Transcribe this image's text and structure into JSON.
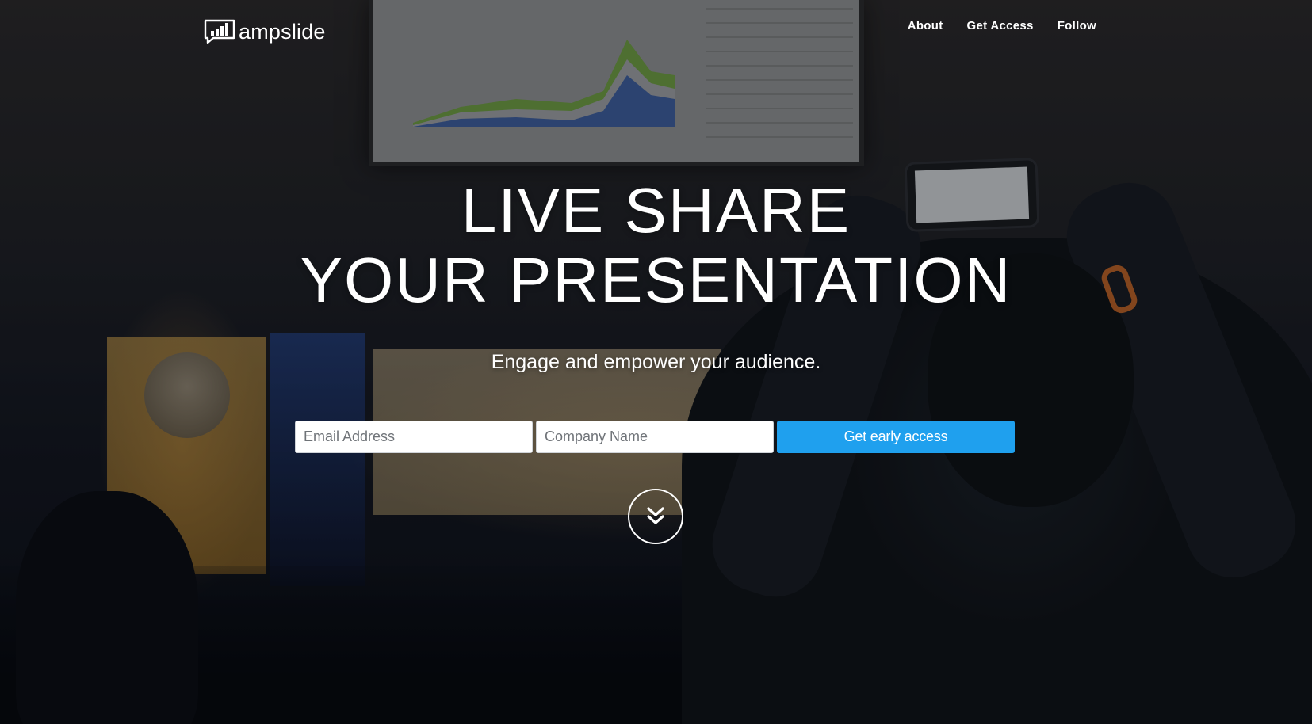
{
  "brand": {
    "name": "ampslide",
    "logo_icon": "presentation-bars-icon"
  },
  "nav": {
    "items": [
      {
        "label": "About"
      },
      {
        "label": "Get Access"
      },
      {
        "label": "Follow"
      }
    ]
  },
  "hero": {
    "headline_line1": "LIVE SHARE",
    "headline_line2": "YOUR PRESENTATION",
    "subheadline": "Engage and empower your audience."
  },
  "signup_form": {
    "email_placeholder": "Email Address",
    "company_placeholder": "Company Name",
    "submit_label": "Get early access"
  },
  "scroll_indicator": {
    "icon": "double-chevron-down-icon"
  },
  "colors": {
    "accent": "#1fa0ee",
    "text": "#ffffff"
  }
}
